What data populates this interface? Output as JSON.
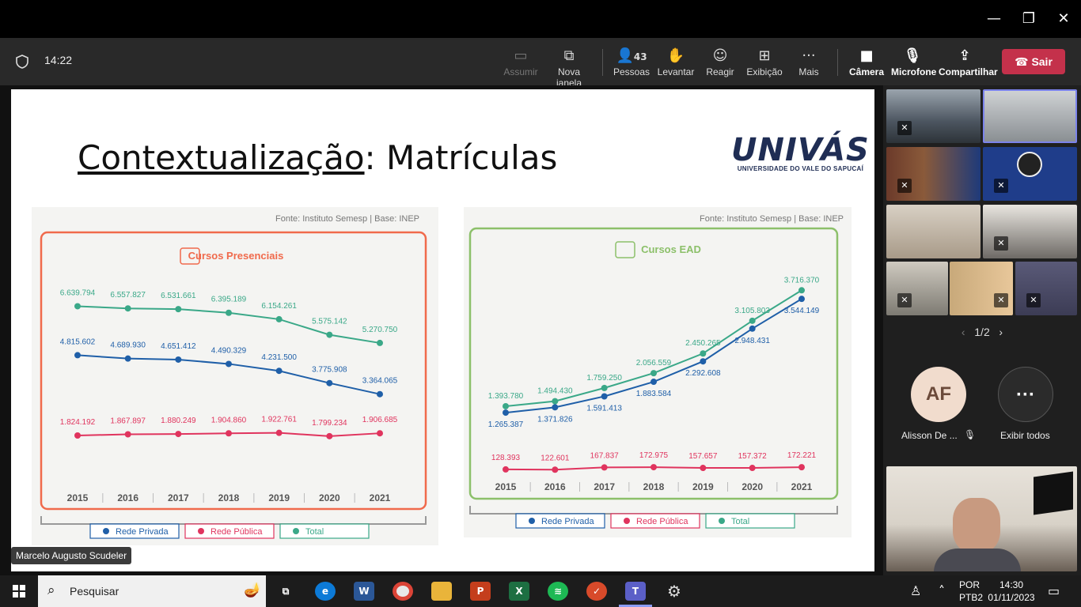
{
  "window": {
    "min": "—",
    "restore": "❐",
    "close": "✕"
  },
  "meeting": {
    "time": "14:22",
    "toolbar": [
      {
        "label": "Assumir",
        "icon": "share-screen-icon"
      },
      {
        "label": "Nova janela",
        "icon": "popout-icon"
      },
      {
        "label": "Pessoas",
        "icon": "people-icon",
        "count": "43"
      },
      {
        "label": "Levantar",
        "icon": "raise-hand-icon"
      },
      {
        "label": "Reagir",
        "icon": "emoji-icon"
      },
      {
        "label": "Exibição",
        "icon": "view-icon"
      },
      {
        "label": "Mais",
        "icon": "more-icon"
      },
      {
        "label": "Câmera",
        "icon": "camera-icon"
      },
      {
        "label": "Microfone",
        "icon": "mic-muted-icon"
      },
      {
        "label": "Compartilhar",
        "icon": "share-icon"
      }
    ],
    "leave": "Sair",
    "presenter": "Marcelo Augusto Scudeler",
    "pager": "1/2",
    "participant_name": "Alisson De ...",
    "participant_initials": "AF",
    "show_all": "Exibir todos"
  },
  "slide": {
    "title_underlined": "Contextualização",
    "title_rest": ": Matrículas",
    "logo": "UNIVÁS",
    "logo_sub": "UNIVERSIDADE DO VALE DO SAPUCAÍ"
  },
  "chart_data": [
    {
      "type": "line",
      "title": "Cursos Presenciais",
      "source": "Fonte: Instituto Semesp | Base: INEP",
      "x": [
        "2015",
        "2016",
        "2017",
        "2018",
        "2019",
        "2020",
        "2021"
      ],
      "series": [
        {
          "name": "Total",
          "color": "#3aa888",
          "values": [
            6639794,
            6557827,
            6531661,
            6395189,
            6154261,
            5575142,
            5270750
          ],
          "labels": [
            "6.639.794",
            "6.557.827",
            "6.531.661",
            "6.395.189",
            "6.154.261",
            "5.575.142",
            "5.270.750"
          ]
        },
        {
          "name": "Rede Privada",
          "color": "#1f5fa8",
          "values": [
            4815602,
            4689930,
            4651412,
            4490329,
            4231500,
            3775908,
            3364065
          ],
          "labels": [
            "4.815.602",
            "4.689.930",
            "4.651.412",
            "4.490.329",
            "4.231.500",
            "3.775.908",
            "3.364.065"
          ]
        },
        {
          "name": "Rede Pública",
          "color": "#e0345e",
          "values": [
            1824192,
            1867897,
            1880249,
            1904860,
            1922761,
            1799234,
            1906685
          ],
          "labels": [
            "1.824.192",
            "1.867.897",
            "1.880.249",
            "1.904.860",
            "1.922.761",
            "1.799.234",
            "1.906.685"
          ]
        }
      ]
    },
    {
      "type": "line",
      "title": "Cursos EAD",
      "source": "Fonte: Instituto Semesp | Base: INEP",
      "x": [
        "2015",
        "2016",
        "2017",
        "2018",
        "2019",
        "2020",
        "2021"
      ],
      "series": [
        {
          "name": "Total",
          "color": "#3aa888",
          "values": [
            1393780,
            1494430,
            1759250,
            2056559,
            2450265,
            3105803,
            3716370
          ],
          "labels": [
            "1.393.780",
            "1.494.430",
            "1.759.250",
            "2.056.559",
            "2.450.265",
            "3.105.803",
            "3.716.370"
          ]
        },
        {
          "name": "Rede Privada",
          "color": "#1f5fa8",
          "values": [
            1265387,
            1371826,
            1591413,
            1883584,
            2292608,
            2948431,
            3544149
          ],
          "labels": [
            "1.265.387",
            "1.371.826",
            "1.591.413",
            "1.883.584",
            "2.292.608",
            "2.948.431",
            "3.544.149"
          ]
        },
        {
          "name": "Rede Pública",
          "color": "#e0345e",
          "values": [
            128393,
            122601,
            167837,
            172975,
            157657,
            157372,
            172221
          ],
          "labels": [
            "128.393",
            "122.601",
            "167.837",
            "172.975",
            "157.657",
            "157.372",
            "172.221"
          ]
        }
      ]
    }
  ],
  "taskbar": {
    "search": "Pesquisar",
    "lang1": "POR",
    "lang2": "PTB2",
    "time": "14:30",
    "date": "01/11/2023"
  }
}
